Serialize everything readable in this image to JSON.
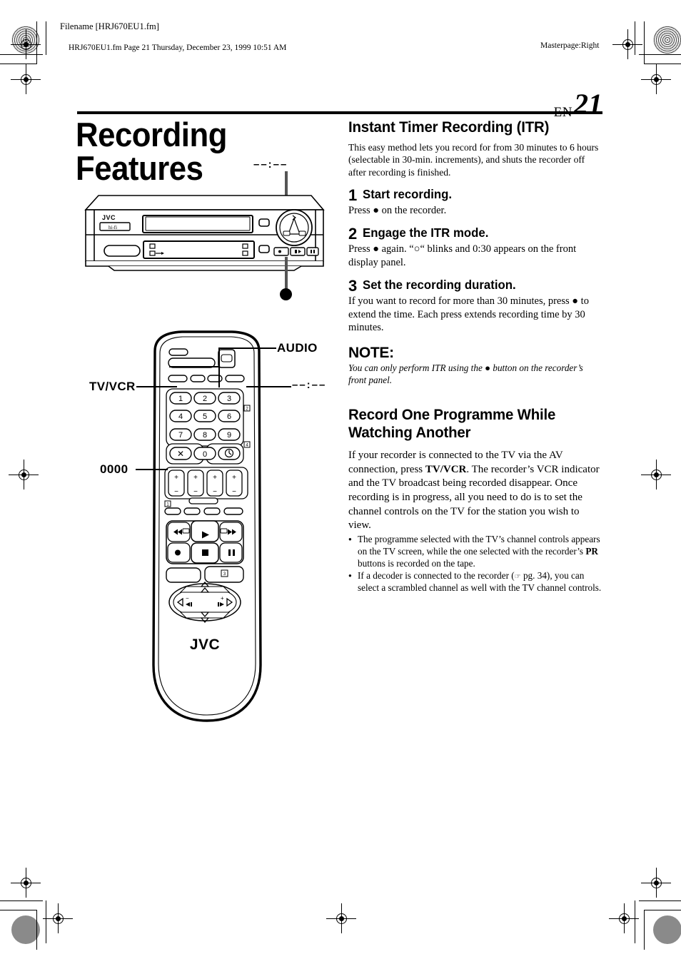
{
  "header": {
    "filename": "Filename [HRJ670EU1.fm]",
    "fileline": "HRJ670EU1.fm  Page 21  Thursday, December 23, 1999  10:51 AM",
    "masterpage": "Masterpage:Right"
  },
  "page": {
    "lang_code": "EN",
    "number": "21",
    "title": "Recording Features"
  },
  "sections": [
    {
      "heading": "Instant Timer Recording (ITR)",
      "intro": "This easy method lets you record for from 30 minutes to 6 hours (selectable in 30-min. increments), and shuts the recorder off after recording is finished.",
      "steps": [
        {
          "num": "1",
          "title": "Start recording.",
          "body": "Press ● on the recorder."
        },
        {
          "num": "2",
          "title": "Engage the ITR mode.",
          "body": "Press ● again. “○“ blinks and 0:30 appears on the front display panel."
        },
        {
          "num": "3",
          "title": "Set the recording duration.",
          "body": "If you want to record for more than 30 minutes, press ● to extend the time. Each press extends recording time by 30 minutes."
        }
      ],
      "note_label": "NOTE:",
      "note_body": "You can only perform ITR using the ● button on the recorder’s front panel."
    },
    {
      "heading_line1": "Record One Programme While",
      "heading_line2": "Watching Another",
      "intro": "If your recorder is connected to the TV via the AV connection, press TV/VCR. The recorder’s VCR indicator and the TV broadcast being recorded disappear. Once recording is in progress, all you need to do is to set the channel controls on the TV for the station you wish to view.",
      "bullets": [
        "The programme selected with the TV’s channel controls appears on the TV screen, while the one selected with the recorder’s PR buttons is recorded on the tape.",
        "If a decoder is connected to the recorder (☞ pg. 34), you can select a scrambled channel as well with the TV channel controls."
      ]
    }
  ],
  "inline_bold": {
    "tv_vcr": "TV/VCR",
    "pr": "PR",
    "pg_ref": "pg. 34"
  },
  "figures": {
    "vcr": {
      "brand": "JVC",
      "display_dashes": "––:––",
      "callout_record_dot": "●"
    },
    "remote": {
      "brand": "JVC",
      "labels": {
        "audio": "AUDIO",
        "tv_vcr": "TV/VCR",
        "zero_code": "0000",
        "display_dashes": "––:––"
      },
      "keypad": [
        "1",
        "2",
        "3",
        "4",
        "5",
        "6",
        "7",
        "8",
        "9",
        "✕",
        "0",
        "⏱"
      ],
      "step_markers": [
        "1",
        "2",
        "4",
        "3"
      ],
      "transport": {
        "rew": "◀◀",
        "play": "▶",
        "ff": "▶▶",
        "record": "●",
        "stop": "■",
        "pause": "‖"
      },
      "nav": {
        "up": "△",
        "down": "▽",
        "left": "◁",
        "right": "▷",
        "minus": "−",
        "plus": "+",
        "prev": "◀◀",
        "next": "▶▶"
      }
    }
  }
}
